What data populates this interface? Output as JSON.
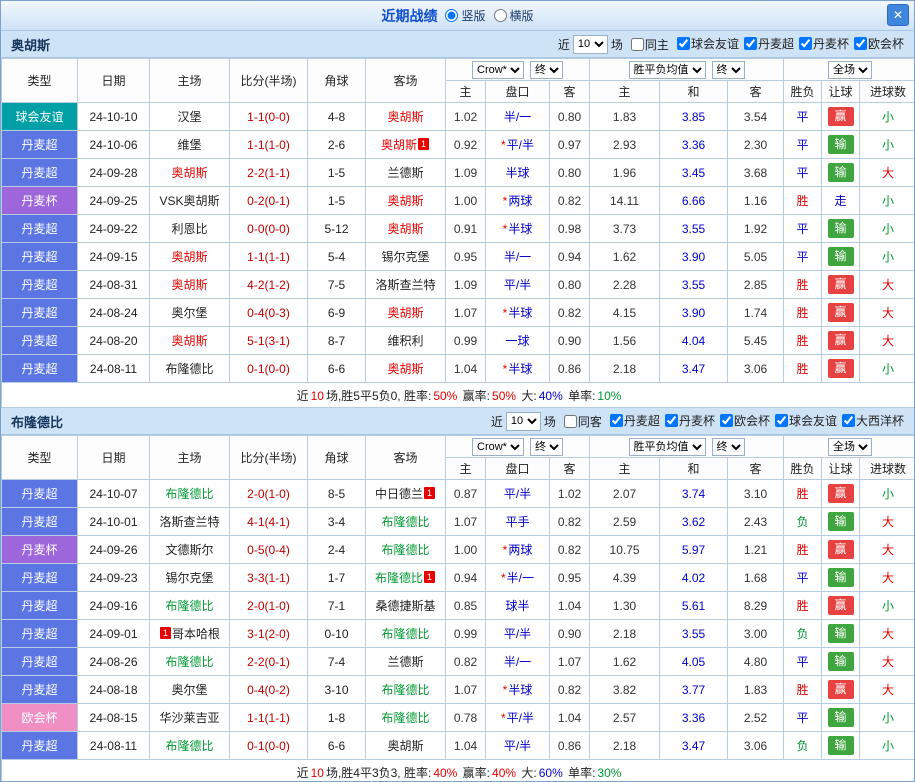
{
  "titlebar": {
    "title": "近期战绩",
    "vertical": "竖版",
    "horizontal": "横版",
    "close": "✕"
  },
  "colors": {
    "accent_blue": "#0f4fd0",
    "league_friendly": "#00a0a6",
    "league_dk_super": "#5b76e3",
    "league_dk_cup": "#9d66db",
    "league_conference": "#f08fc4",
    "win_badge": "#e84141",
    "lose_badge": "#3fa53f",
    "text_red": "#e60000",
    "text_green": "#009933",
    "text_blue": "#0000cc",
    "score_red": "#c00000"
  },
  "sections": [
    {
      "team": "奥胡斯",
      "filters": {
        "near": "近",
        "count": "10",
        "games": "场",
        "same": "同主",
        "same_checked": false,
        "leagues": [
          {
            "label": "球会友谊",
            "checked": true
          },
          {
            "label": "丹麦超",
            "checked": true
          },
          {
            "label": "丹麦杯",
            "checked": true
          },
          {
            "label": "欧会杯",
            "checked": true
          }
        ]
      },
      "header": {
        "type": "类型",
        "date": "日期",
        "home": "主场",
        "score": "比分(半场)",
        "corner": "角球",
        "away": "客场",
        "odds_select": "Crow*",
        "final1": "终",
        "avg_select": "胜平负均值",
        "final2": "终",
        "scope_select": "全场",
        "sub": [
          "主",
          "盘口",
          "客",
          "主",
          "和",
          "客",
          "胜负",
          "让球",
          "进球数"
        ]
      },
      "rows": [
        {
          "league": "球会友谊",
          "lc": "#00a0a6",
          "date": "24-10-10",
          "home": "汉堡",
          "hc": "",
          "hb": "",
          "hbp": "",
          "score": "1-1(0-0)",
          "corner": "4-8",
          "away": "奥胡斯",
          "ac": "red",
          "ab": "",
          "abp": "",
          "o1": "1.02",
          "star": false,
          "hcp": "半/一",
          "o2": "0.80",
          "a1": "1.83",
          "a2": "3.85",
          "a3": "3.54",
          "res": "平",
          "resc": "blue",
          "let": "赢",
          "letc": "win",
          "big": "小",
          "bigc": "green"
        },
        {
          "league": "丹麦超",
          "lc": "#5b76e3",
          "date": "24-10-06",
          "home": "维堡",
          "hc": "",
          "hb": "",
          "hbp": "",
          "score": "1-1(1-0)",
          "corner": "2-6",
          "away": "奥胡斯",
          "ac": "red",
          "ab": "1",
          "abp": "after",
          "o1": "0.92",
          "star": true,
          "hcp": "平/半",
          "o2": "0.97",
          "a1": "2.93",
          "a2": "3.36",
          "a3": "2.30",
          "res": "平",
          "resc": "blue",
          "let": "输",
          "letc": "lose",
          "big": "小",
          "bigc": "green"
        },
        {
          "league": "丹麦超",
          "lc": "#5b76e3",
          "date": "24-09-28",
          "home": "奥胡斯",
          "hc": "red",
          "hb": "",
          "hbp": "",
          "score": "2-2(1-1)",
          "corner": "1-5",
          "away": "兰德斯",
          "ac": "",
          "ab": "",
          "abp": "",
          "o1": "1.09",
          "star": false,
          "hcp": "半球",
          "o2": "0.80",
          "a1": "1.96",
          "a2": "3.45",
          "a3": "3.68",
          "res": "平",
          "resc": "blue",
          "let": "输",
          "letc": "lose",
          "big": "大",
          "bigc": "red"
        },
        {
          "league": "丹麦杯",
          "lc": "#9d66db",
          "date": "24-09-25",
          "home": "VSK奥胡斯",
          "hc": "",
          "hb": "",
          "hbp": "",
          "score": "0-2(0-1)",
          "corner": "1-5",
          "away": "奥胡斯",
          "ac": "red",
          "ab": "",
          "abp": "",
          "o1": "1.00",
          "star": true,
          "hcp": "两球",
          "o2": "0.82",
          "a1": "14.11",
          "a2": "6.66",
          "a3": "1.16",
          "res": "胜",
          "resc": "red",
          "let": "走",
          "letc": "push",
          "big": "小",
          "bigc": "green"
        },
        {
          "league": "丹麦超",
          "lc": "#5b76e3",
          "date": "24-09-22",
          "home": "利恩比",
          "hc": "",
          "hb": "",
          "hbp": "",
          "score": "0-0(0-0)",
          "corner": "5-12",
          "away": "奥胡斯",
          "ac": "red",
          "ab": "",
          "abp": "",
          "o1": "0.91",
          "star": true,
          "hcp": "半球",
          "o2": "0.98",
          "a1": "3.73",
          "a2": "3.55",
          "a3": "1.92",
          "res": "平",
          "resc": "blue",
          "let": "输",
          "letc": "lose",
          "big": "小",
          "bigc": "green"
        },
        {
          "league": "丹麦超",
          "lc": "#5b76e3",
          "date": "24-09-15",
          "home": "奥胡斯",
          "hc": "red",
          "hb": "",
          "hbp": "",
          "score": "1-1(1-1)",
          "corner": "5-4",
          "away": "锡尔克堡",
          "ac": "",
          "ab": "",
          "abp": "",
          "o1": "0.95",
          "star": false,
          "hcp": "半/一",
          "o2": "0.94",
          "a1": "1.62",
          "a2": "3.90",
          "a3": "5.05",
          "res": "平",
          "resc": "blue",
          "let": "输",
          "letc": "lose",
          "big": "小",
          "bigc": "green"
        },
        {
          "league": "丹麦超",
          "lc": "#5b76e3",
          "date": "24-08-31",
          "home": "奥胡斯",
          "hc": "red",
          "hb": "",
          "hbp": "",
          "score": "4-2(1-2)",
          "corner": "7-5",
          "away": "洛斯查兰特",
          "ac": "",
          "ab": "",
          "abp": "",
          "o1": "1.09",
          "star": false,
          "hcp": "平/半",
          "o2": "0.80",
          "a1": "2.28",
          "a2": "3.55",
          "a3": "2.85",
          "res": "胜",
          "resc": "red",
          "let": "赢",
          "letc": "win",
          "big": "大",
          "bigc": "red"
        },
        {
          "league": "丹麦超",
          "lc": "#5b76e3",
          "date": "24-08-24",
          "home": "奥尔堡",
          "hc": "",
          "hb": "",
          "hbp": "",
          "score": "0-4(0-3)",
          "corner": "6-9",
          "away": "奥胡斯",
          "ac": "red",
          "ab": "",
          "abp": "",
          "o1": "1.07",
          "star": true,
          "hcp": "半球",
          "o2": "0.82",
          "a1": "4.15",
          "a2": "3.90",
          "a3": "1.74",
          "res": "胜",
          "resc": "red",
          "let": "赢",
          "letc": "win",
          "big": "大",
          "bigc": "red"
        },
        {
          "league": "丹麦超",
          "lc": "#5b76e3",
          "date": "24-08-20",
          "home": "奥胡斯",
          "hc": "red",
          "hb": "",
          "hbp": "",
          "score": "5-1(3-1)",
          "corner": "8-7",
          "away": "维积利",
          "ac": "",
          "ab": "",
          "abp": "",
          "o1": "0.99",
          "star": false,
          "hcp": "一球",
          "o2": "0.90",
          "a1": "1.56",
          "a2": "4.04",
          "a3": "5.45",
          "res": "胜",
          "resc": "red",
          "let": "赢",
          "letc": "win",
          "big": "大",
          "bigc": "red"
        },
        {
          "league": "丹麦超",
          "lc": "#5b76e3",
          "date": "24-08-11",
          "home": "布隆德比",
          "hc": "",
          "hb": "",
          "hbp": "",
          "score": "0-1(0-0)",
          "corner": "6-6",
          "away": "奥胡斯",
          "ac": "red",
          "ab": "",
          "abp": "",
          "o1": "1.04",
          "star": true,
          "hcp": "半球",
          "o2": "0.86",
          "a1": "2.18",
          "a2": "3.47",
          "a3": "3.06",
          "res": "胜",
          "resc": "red",
          "let": "赢",
          "letc": "win",
          "big": "小",
          "bigc": "green"
        }
      ],
      "summary": [
        {
          "t": "近",
          "c": ""
        },
        {
          "t": "10",
          "c": "red"
        },
        {
          "t": "场,胜5平5负0, 胜率:",
          "c": ""
        },
        {
          "t": "50%",
          "c": "red"
        },
        {
          "t": " 赢率:",
          "c": ""
        },
        {
          "t": "50%",
          "c": "red"
        },
        {
          "t": " 大:",
          "c": ""
        },
        {
          "t": "40%",
          "c": "blue"
        },
        {
          "t": " 单率:",
          "c": ""
        },
        {
          "t": "10%",
          "c": "green"
        }
      ]
    },
    {
      "team": "布隆德比",
      "filters": {
        "near": "近",
        "count": "10",
        "games": "场",
        "same": "同客",
        "same_checked": false,
        "leagues": [
          {
            "label": "丹麦超",
            "checked": true
          },
          {
            "label": "丹麦杯",
            "checked": true
          },
          {
            "label": "欧会杯",
            "checked": true
          },
          {
            "label": "球会友谊",
            "checked": true
          },
          {
            "label": "大西洋杯",
            "checked": true
          }
        ]
      },
      "header": {
        "type": "类型",
        "date": "日期",
        "home": "主场",
        "score": "比分(半场)",
        "corner": "角球",
        "away": "客场",
        "odds_select": "Crow*",
        "final1": "终",
        "avg_select": "胜平负均值",
        "final2": "终",
        "scope_select": "全场",
        "sub": [
          "主",
          "盘口",
          "客",
          "主",
          "和",
          "客",
          "胜负",
          "让球",
          "进球数"
        ]
      },
      "rows": [
        {
          "league": "丹麦超",
          "lc": "#5b76e3",
          "date": "24-10-07",
          "home": "布隆德比",
          "hc": "green",
          "hb": "",
          "hbp": "",
          "score": "2-0(1-0)",
          "corner": "8-5",
          "away": "中日德兰",
          "ac": "",
          "ab": "1",
          "abp": "after",
          "o1": "0.87",
          "star": false,
          "hcp": "平/半",
          "o2": "1.02",
          "a1": "2.07",
          "a2": "3.74",
          "a3": "3.10",
          "res": "胜",
          "resc": "red",
          "let": "赢",
          "letc": "win",
          "big": "小",
          "bigc": "green"
        },
        {
          "league": "丹麦超",
          "lc": "#5b76e3",
          "date": "24-10-01",
          "home": "洛斯查兰特",
          "hc": "",
          "hb": "",
          "hbp": "",
          "score": "4-1(4-1)",
          "corner": "3-4",
          "away": "布隆德比",
          "ac": "green",
          "ab": "",
          "abp": "",
          "o1": "1.07",
          "star": false,
          "hcp": "平手",
          "o2": "0.82",
          "a1": "2.59",
          "a2": "3.62",
          "a3": "2.43",
          "res": "负",
          "resc": "green",
          "let": "输",
          "letc": "lose",
          "big": "大",
          "bigc": "red"
        },
        {
          "league": "丹麦杯",
          "lc": "#9d66db",
          "date": "24-09-26",
          "home": "文德斯尔",
          "hc": "",
          "hb": "",
          "hbp": "",
          "score": "0-5(0-4)",
          "corner": "2-4",
          "away": "布隆德比",
          "ac": "green",
          "ab": "",
          "abp": "",
          "o1": "1.00",
          "star": true,
          "hcp": "两球",
          "o2": "0.82",
          "a1": "10.75",
          "a2": "5.97",
          "a3": "1.21",
          "res": "胜",
          "resc": "red",
          "let": "赢",
          "letc": "win",
          "big": "大",
          "bigc": "red"
        },
        {
          "league": "丹麦超",
          "lc": "#5b76e3",
          "date": "24-09-23",
          "home": "锡尔克堡",
          "hc": "",
          "hb": "",
          "hbp": "",
          "score": "3-3(1-1)",
          "corner": "1-7",
          "away": "布隆德比",
          "ac": "green",
          "ab": "1",
          "abp": "after",
          "o1": "0.94",
          "star": true,
          "hcp": "半/一",
          "o2": "0.95",
          "a1": "4.39",
          "a2": "4.02",
          "a3": "1.68",
          "res": "平",
          "resc": "blue",
          "let": "输",
          "letc": "lose",
          "big": "大",
          "bigc": "red"
        },
        {
          "league": "丹麦超",
          "lc": "#5b76e3",
          "date": "24-09-16",
          "home": "布隆德比",
          "hc": "green",
          "hb": "",
          "hbp": "",
          "score": "2-0(1-0)",
          "corner": "7-1",
          "away": "桑德捷斯基",
          "ac": "",
          "ab": "",
          "abp": "",
          "o1": "0.85",
          "star": false,
          "hcp": "球半",
          "o2": "1.04",
          "a1": "1.30",
          "a2": "5.61",
          "a3": "8.29",
          "res": "胜",
          "resc": "red",
          "let": "赢",
          "letc": "win",
          "big": "小",
          "bigc": "green"
        },
        {
          "league": "丹麦超",
          "lc": "#5b76e3",
          "date": "24-09-01",
          "home": "哥本哈根",
          "hc": "",
          "hb": "1",
          "hbp": "before",
          "score": "3-1(2-0)",
          "corner": "0-10",
          "away": "布隆德比",
          "ac": "green",
          "ab": "",
          "abp": "",
          "o1": "0.99",
          "star": false,
          "hcp": "平/半",
          "o2": "0.90",
          "a1": "2.18",
          "a2": "3.55",
          "a3": "3.00",
          "res": "负",
          "resc": "green",
          "let": "输",
          "letc": "lose",
          "big": "大",
          "bigc": "red"
        },
        {
          "league": "丹麦超",
          "lc": "#5b76e3",
          "date": "24-08-26",
          "home": "布隆德比",
          "hc": "green",
          "hb": "",
          "hbp": "",
          "score": "2-2(0-1)",
          "corner": "7-4",
          "away": "兰德斯",
          "ac": "",
          "ab": "",
          "abp": "",
          "o1": "0.82",
          "star": false,
          "hcp": "半/一",
          "o2": "1.07",
          "a1": "1.62",
          "a2": "4.05",
          "a3": "4.80",
          "res": "平",
          "resc": "blue",
          "let": "输",
          "letc": "lose",
          "big": "大",
          "bigc": "red"
        },
        {
          "league": "丹麦超",
          "lc": "#5b76e3",
          "date": "24-08-18",
          "home": "奥尔堡",
          "hc": "",
          "hb": "",
          "hbp": "",
          "score": "0-4(0-2)",
          "corner": "3-10",
          "away": "布隆德比",
          "ac": "green",
          "ab": "",
          "abp": "",
          "o1": "1.07",
          "star": true,
          "hcp": "半球",
          "o2": "0.82",
          "a1": "3.82",
          "a2": "3.77",
          "a3": "1.83",
          "res": "胜",
          "resc": "red",
          "let": "赢",
          "letc": "win",
          "big": "大",
          "bigc": "red"
        },
        {
          "league": "欧会杯",
          "lc": "#f08fc4",
          "date": "24-08-15",
          "home": "华沙莱吉亚",
          "hc": "",
          "hb": "",
          "hbp": "",
          "score": "1-1(1-1)",
          "corner": "1-8",
          "away": "布隆德比",
          "ac": "green",
          "ab": "",
          "abp": "",
          "o1": "0.78",
          "star": true,
          "hcp": "平/半",
          "o2": "1.04",
          "a1": "2.57",
          "a2": "3.36",
          "a3": "2.52",
          "res": "平",
          "resc": "blue",
          "let": "输",
          "letc": "lose",
          "big": "小",
          "bigc": "green"
        },
        {
          "league": "丹麦超",
          "lc": "#5b76e3",
          "date": "24-08-11",
          "home": "布隆德比",
          "hc": "green",
          "hb": "",
          "hbp": "",
          "score": "0-1(0-0)",
          "corner": "6-6",
          "away": "奥胡斯",
          "ac": "",
          "ab": "",
          "abp": "",
          "o1": "1.04",
          "star": false,
          "hcp": "平/半",
          "o2": "0.86",
          "a1": "2.18",
          "a2": "3.47",
          "a3": "3.06",
          "res": "负",
          "resc": "green",
          "let": "输",
          "letc": "lose",
          "big": "小",
          "bigc": "green"
        }
      ],
      "summary": [
        {
          "t": "近",
          "c": ""
        },
        {
          "t": "10",
          "c": "red"
        },
        {
          "t": "场,胜4平3负3, 胜率:",
          "c": ""
        },
        {
          "t": "40%",
          "c": "red"
        },
        {
          "t": " 赢率:",
          "c": ""
        },
        {
          "t": "40%",
          "c": "red"
        },
        {
          "t": " 大:",
          "c": ""
        },
        {
          "t": "60%",
          "c": "blue"
        },
        {
          "t": " 单率:",
          "c": ""
        },
        {
          "t": "30%",
          "c": "green"
        }
      ]
    }
  ]
}
